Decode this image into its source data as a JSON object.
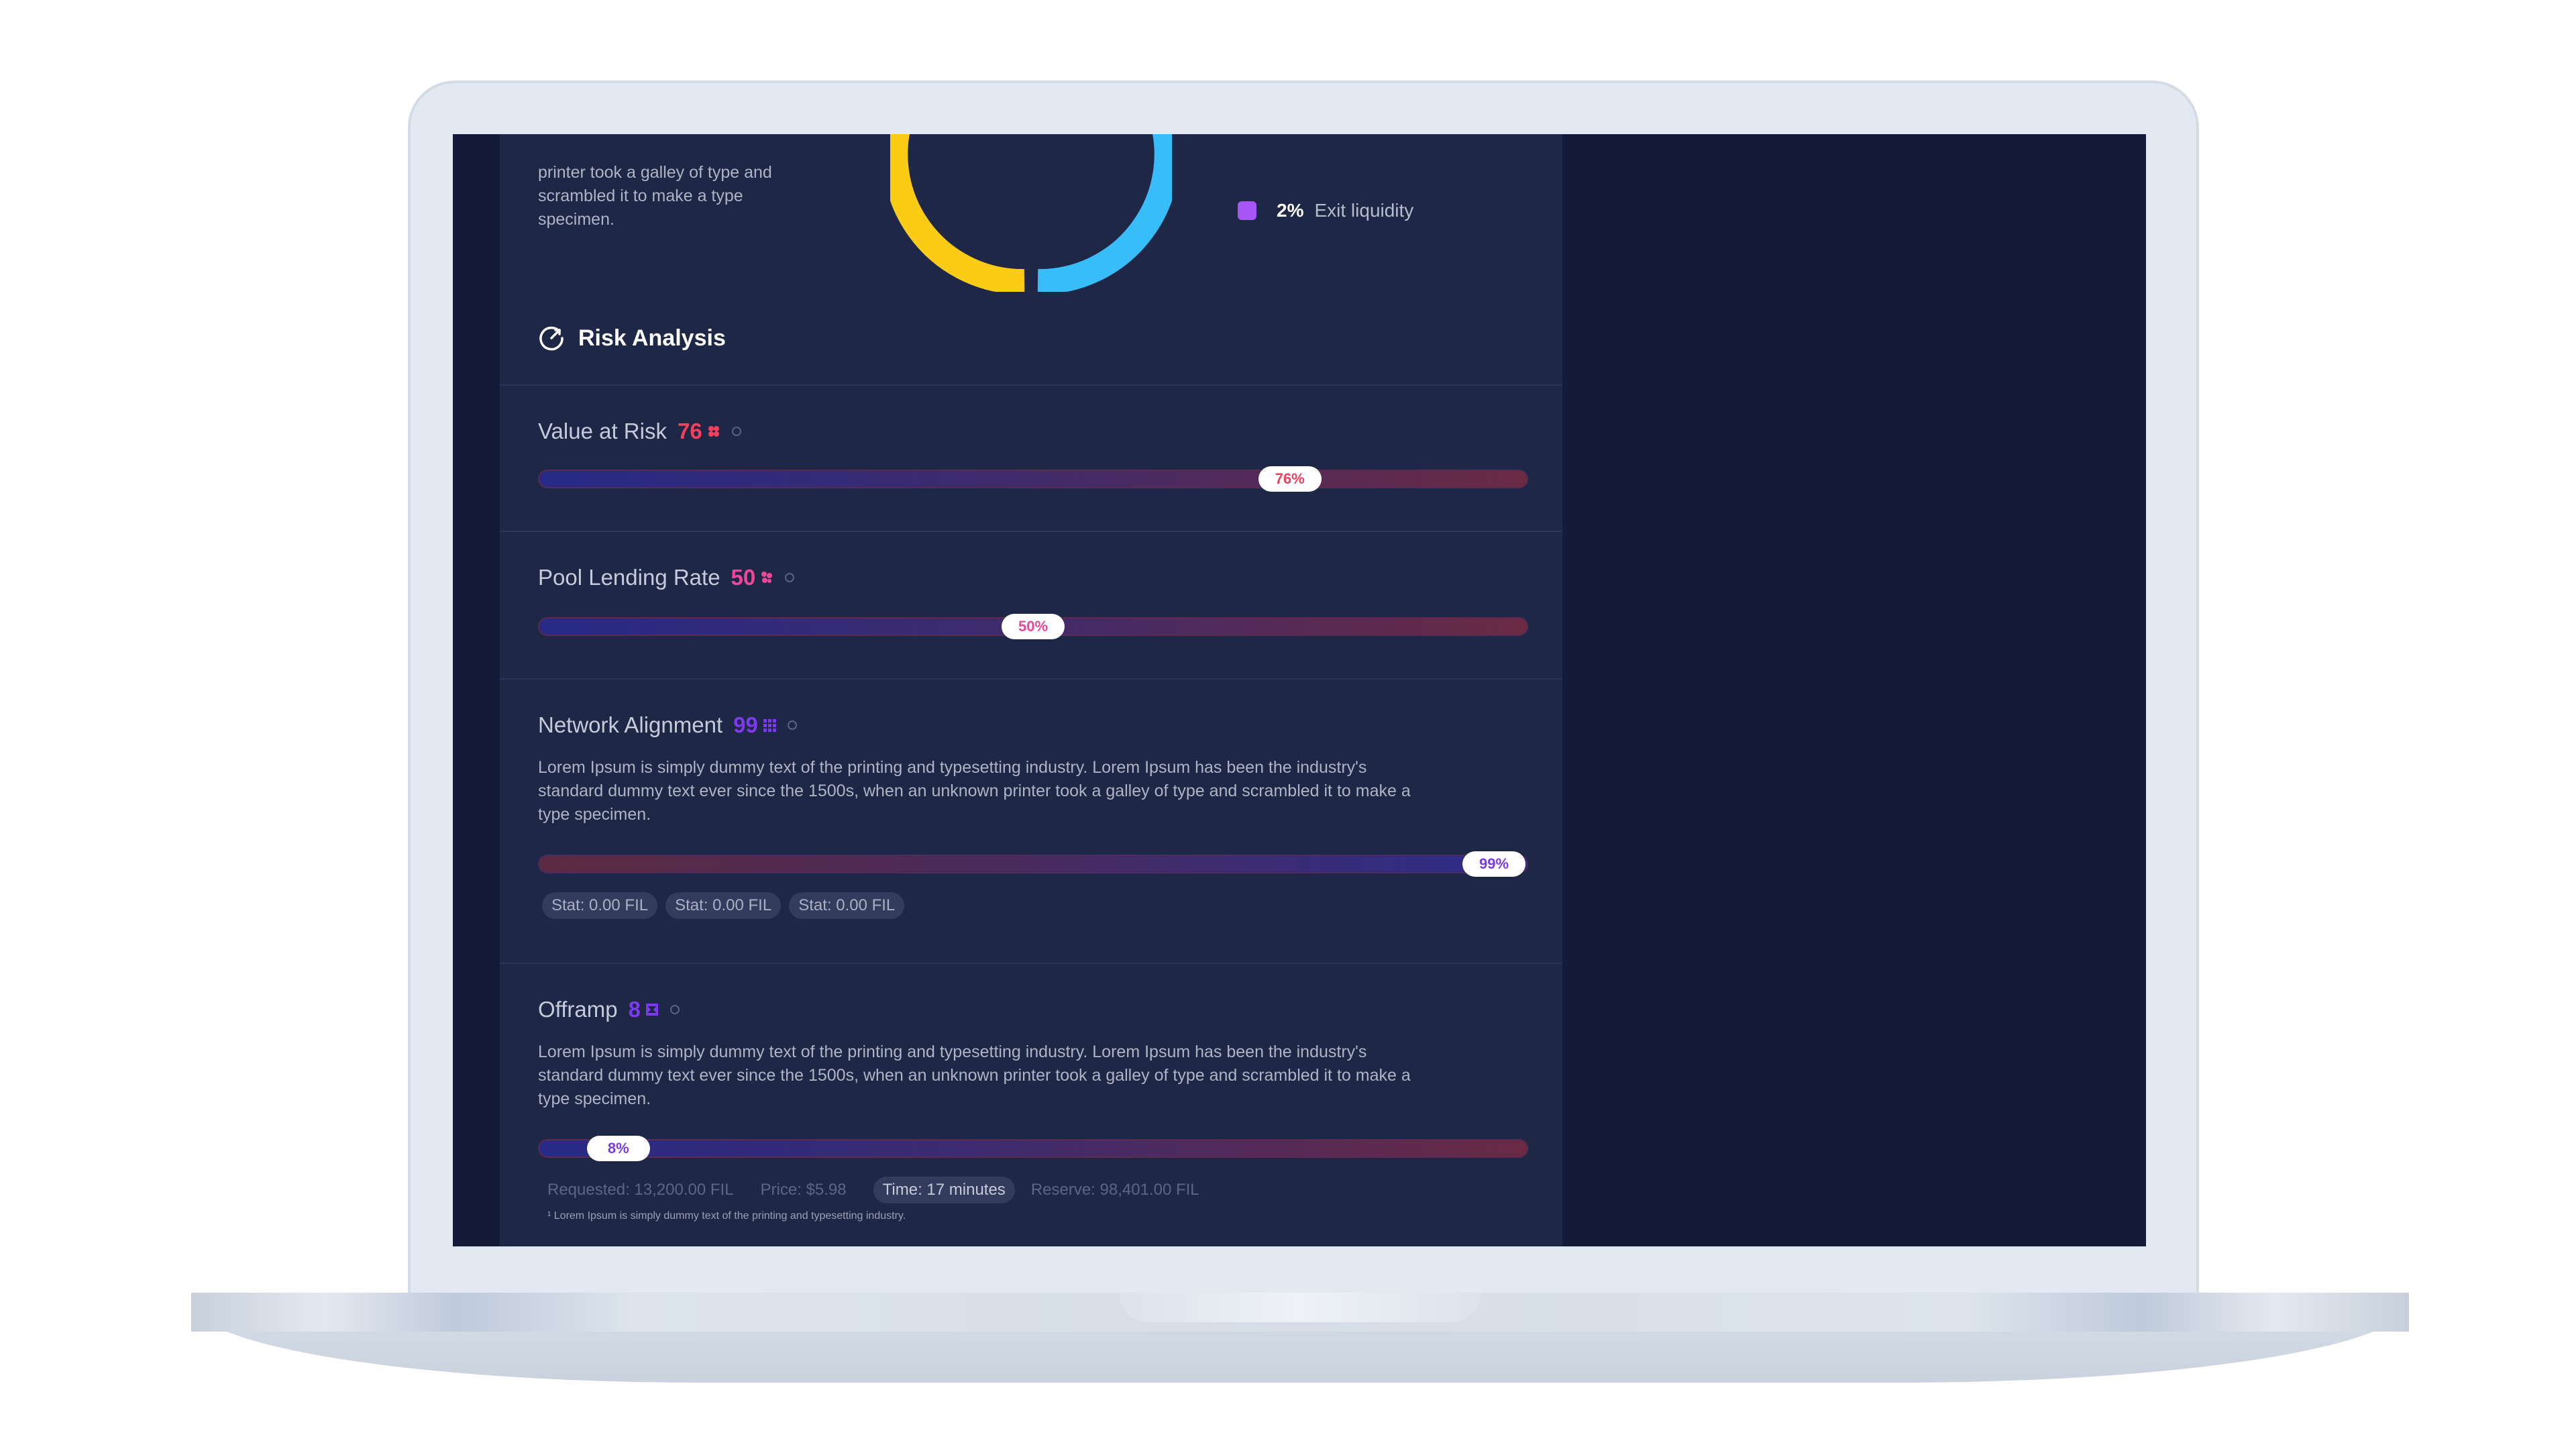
{
  "overview": {
    "description_fragment": "printer took a galley of type and scrambled it to make a type specimen.",
    "legend": {
      "percent": "2%",
      "label": "Exit liquidity",
      "color": "#a855f7"
    },
    "donut_colors": [
      "#facc15",
      "#38bdf8"
    ]
  },
  "risk": {
    "title": "Risk Analysis",
    "icon": "gauge-icon",
    "items": [
      {
        "name": "Value at Risk",
        "score": "76",
        "score_color": "#f43f5e",
        "value": 0.76,
        "pill": "76%",
        "style": "up"
      },
      {
        "name": "Pool Lending Rate",
        "score": "50",
        "score_color": "#ec4899",
        "value": 0.5,
        "pill": "50%",
        "style": "up"
      },
      {
        "name": "Network Alignment",
        "score": "99",
        "score_color": "#7c3aed",
        "value": 0.99,
        "pill": "99%",
        "style": "rev",
        "description": "Lorem Ipsum is simply dummy text of the printing and typesetting industry. Lorem Ipsum has been the industry's standard dummy text ever since the 1500s, when an unknown printer took a galley of type and scrambled it to make a type specimen.",
        "stats": [
          "Stat: 0.00 FIL",
          "Stat: 0.00 FIL",
          "Stat: 0.00 FIL"
        ]
      },
      {
        "name": "Offramp",
        "score": "8",
        "score_color": "#7c3aed",
        "value": 0.08,
        "pill": "8%",
        "style": "up",
        "description": "Lorem Ipsum is simply dummy text of the printing and typesetting industry. Lorem Ipsum has been the industry's standard dummy text ever since the 1500s, when an unknown printer took a galley of type and scrambled it to make a type specimen.",
        "requested": "Requested: 13,200.00 FIL",
        "price": "Price: $5.98",
        "time": "Time: 17 minutes",
        "reserve": "Reserve: 98,401.00 FIL",
        "footnote": "¹ Lorem Ipsum is simply dummy text of the printing and typesetting industry."
      }
    ]
  }
}
